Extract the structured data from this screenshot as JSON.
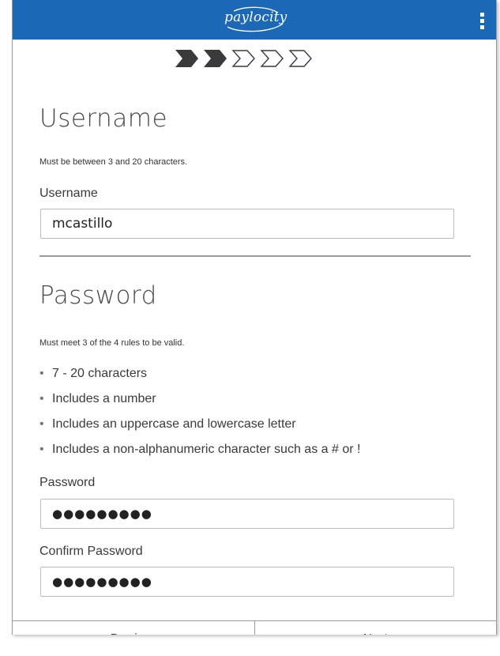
{
  "header": {
    "logo_text": "paylocity",
    "brand_color": "#1b68b7",
    "menu_icon": "kebab-menu-icon"
  },
  "stepper": {
    "total_steps": 5,
    "completed_steps": 2,
    "step_icon": "chevron-step-icon"
  },
  "username_section": {
    "heading": "Username",
    "hint": "Must be between 3 and 20 characters.",
    "field_label": "Username",
    "field_value": "mcastillo"
  },
  "password_section": {
    "heading": "Password",
    "hint": "Must meet 3 of the 4 rules to be valid.",
    "rules": [
      "7 - 20 characters",
      "Includes a number",
      "Includes an uppercase and lowercase letter",
      "Includes a non-alphanumeric character such as a # or !"
    ],
    "password_label": "Password",
    "password_value": "●●●●●●●●●",
    "confirm_label": "Confirm Password",
    "confirm_value": "●●●●●●●●●"
  },
  "footer": {
    "previous_label": "Previous",
    "next_label": "Next"
  }
}
